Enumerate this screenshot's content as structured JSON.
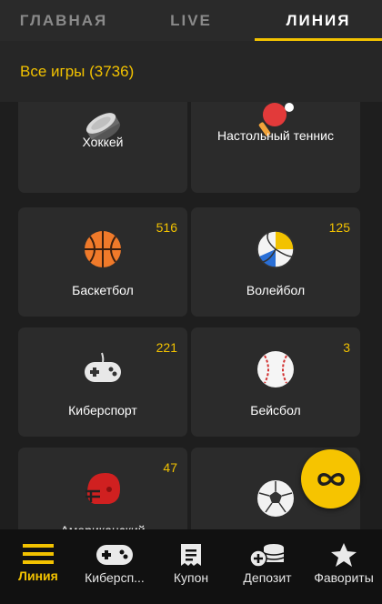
{
  "tabs": [
    {
      "label": "ГЛАВНАЯ"
    },
    {
      "label": "LIVE"
    },
    {
      "label": "ЛИНИЯ"
    }
  ],
  "active_tab": "ЛИНИЯ",
  "filter": {
    "label": "Все игры (3736)"
  },
  "sports": [
    {
      "name": "Хоккей",
      "count": "",
      "icon": "hockey-puck-icon"
    },
    {
      "name": "Настольный теннис",
      "count": "",
      "icon": "table-tennis-icon"
    },
    {
      "name": "Баскетбол",
      "count": "516",
      "icon": "basketball-icon"
    },
    {
      "name": "Волейбол",
      "count": "125",
      "icon": "volleyball-icon"
    },
    {
      "name": "Киберспорт",
      "count": "221",
      "icon": "gamepad-icon"
    },
    {
      "name": "Бейсбол",
      "count": "3",
      "icon": "baseball-icon"
    },
    {
      "name": "Американский",
      "count": "47",
      "icon": "football-helmet-icon"
    },
    {
      "name": "",
      "count": "",
      "icon": "handball-icon"
    }
  ],
  "fab": {
    "icon": "infinity-icon"
  },
  "bottom_nav": [
    {
      "label": "Линия",
      "icon": "menu-lines-icon",
      "active": true
    },
    {
      "label": "Киберсп...",
      "icon": "gamepad-icon",
      "active": false
    },
    {
      "label": "Купон",
      "icon": "coupon-icon",
      "active": false
    },
    {
      "label": "Депозит",
      "icon": "coins-icon",
      "active": false
    },
    {
      "label": "Фавориты",
      "icon": "star-icon",
      "active": false
    }
  ],
  "colors": {
    "accent": "#f2c200",
    "background": "#1e1e1e",
    "card": "#2b2b2b",
    "nav": "#111111"
  }
}
